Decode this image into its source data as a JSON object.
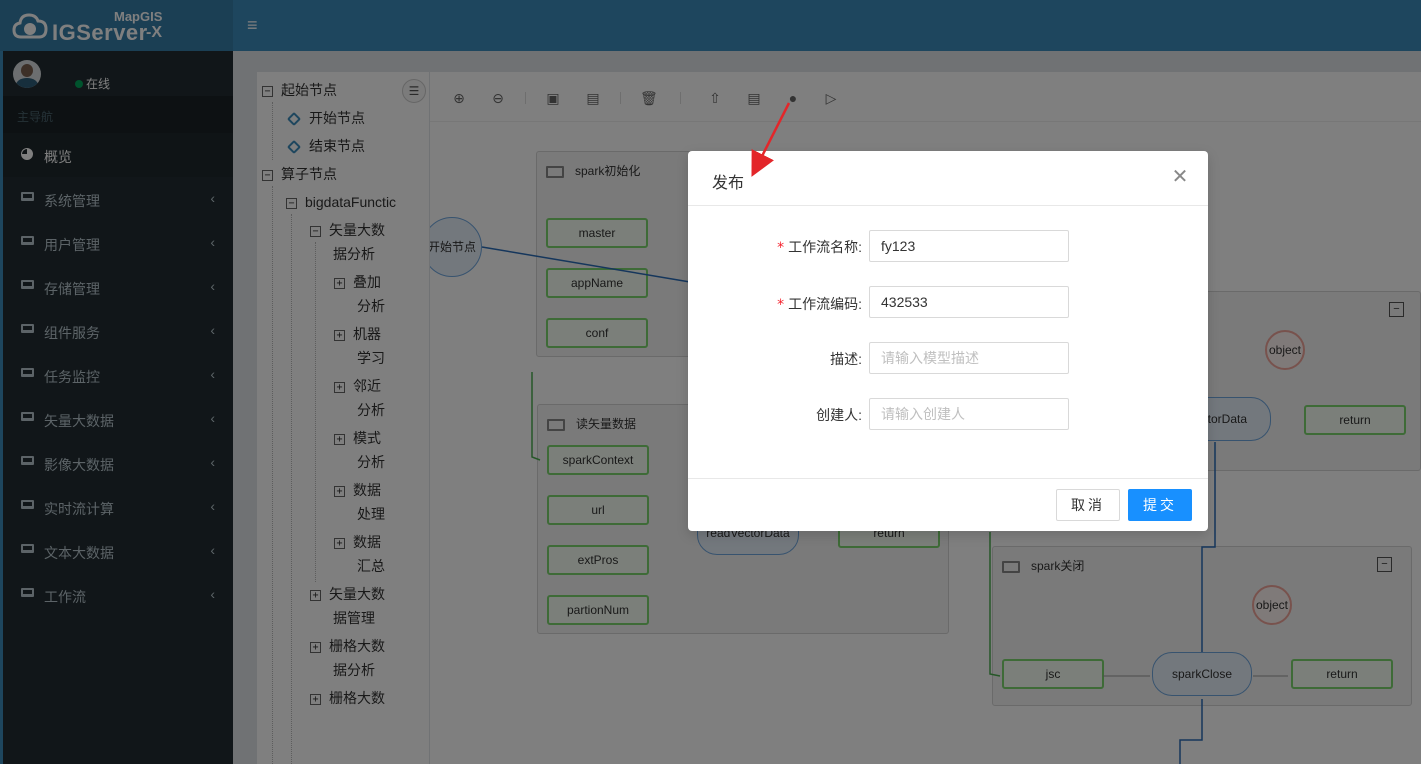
{
  "brand": {
    "mapgis": "MapGIS",
    "name": "IGServer",
    "suffix": "-X"
  },
  "user": {
    "status": "在线"
  },
  "nav": {
    "header": "主导航",
    "items": [
      {
        "label": "概览",
        "icon": "pie-chart-icon",
        "active": true
      },
      {
        "label": "系统管理",
        "icon": "laptop-icon"
      },
      {
        "label": "用户管理",
        "icon": "laptop-icon"
      },
      {
        "label": "存储管理",
        "icon": "laptop-icon"
      },
      {
        "label": "组件服务",
        "icon": "laptop-icon"
      },
      {
        "label": "任务监控",
        "icon": "laptop-icon"
      },
      {
        "label": "矢量大数据",
        "icon": "laptop-icon"
      },
      {
        "label": "影像大数据",
        "icon": "laptop-icon"
      },
      {
        "label": "实时流计算",
        "icon": "laptop-icon"
      },
      {
        "label": "文本大数据",
        "icon": "laptop-icon"
      },
      {
        "label": "工作流",
        "icon": "laptop-icon"
      }
    ]
  },
  "tree": {
    "start_group": "起始节点",
    "start_node": "开始节点",
    "end_node": "结束节点",
    "operator_group": "算子节点",
    "bigdata": "bigdataFunctic",
    "vector_analysis_1": "矢量大数",
    "vector_analysis_2": "据分析",
    "overlay_1": "叠加",
    "overlay_2": "分析",
    "ml_1": "机器",
    "ml_2": "学习",
    "neighbor_1": "邻近",
    "neighbor_2": "分析",
    "pattern_1": "模式",
    "pattern_2": "分析",
    "dataproc_1": "数据",
    "dataproc_2": "处理",
    "summary_1": "数据",
    "summary_2": "汇总",
    "vector_mgmt_1": "矢量大数",
    "vector_mgmt_2": "据管理",
    "raster_1": "栅格大数",
    "raster_2": "据分析",
    "raster_more": "栅格大数"
  },
  "canvas": {
    "start_circle": "开始节点",
    "spark_init": {
      "title": "spark初始化",
      "params": [
        "master",
        "appName",
        "conf"
      ]
    },
    "read_vector": {
      "title": "读矢量数据",
      "params": [
        "sparkContext",
        "url",
        "extPros",
        "partionNum"
      ],
      "func": "readVectorData",
      "out": "return"
    },
    "right_group": {
      "func": "ectorData",
      "obj": "object",
      "out": "return"
    },
    "spark_close": {
      "title": "spark关闭",
      "param": "jsc",
      "func": "sparkClose",
      "obj": "object",
      "out": "return"
    }
  },
  "dialog": {
    "title": "发布",
    "fields": [
      {
        "label": "工作流名称:",
        "required": true,
        "value": "fy123",
        "placeholder": ""
      },
      {
        "label": "工作流编码:",
        "required": true,
        "value": "432533",
        "placeholder": ""
      },
      {
        "label": "描述:",
        "required": false,
        "value": "",
        "placeholder": "请输入模型描述"
      },
      {
        "label": "创建人:",
        "required": false,
        "value": "",
        "placeholder": "请输入创建人"
      }
    ],
    "cancel": "取消",
    "submit": "提交"
  },
  "colors": {
    "header": "#3c8dbc",
    "sidebar": "#222d32",
    "primary": "#1890ff",
    "annotation_arrow": "#e3262a"
  }
}
